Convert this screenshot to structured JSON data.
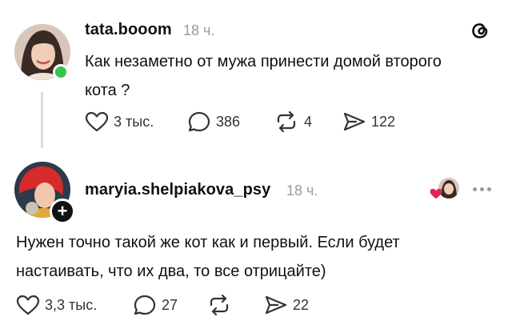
{
  "post": {
    "username": "tata.booom",
    "time": "18 ч.",
    "text_line1": "Как незаметно от мужа принести домой второго",
    "text_line2": "кота ?",
    "likes": "3 тыс.",
    "comments": "386",
    "reposts": "4",
    "shares": "122"
  },
  "reply": {
    "username": "maryia.shelpiakova_psy",
    "time": "18 ч.",
    "text_line1": "Нужен точно такой же кот как и первый. Если будет",
    "text_line2": "настаивать, что их два, то все отрицайте)",
    "likes": "3,3 тыс.",
    "comments": "27",
    "shares": "22"
  },
  "colors": {
    "online": "#39c44a",
    "like_heart": "#e0245e",
    "muted": "#9a9a9a"
  },
  "icons": [
    "threads-logo-icon",
    "heart-icon",
    "comment-icon",
    "repost-icon",
    "share-icon",
    "plus-icon",
    "more-icon"
  ]
}
